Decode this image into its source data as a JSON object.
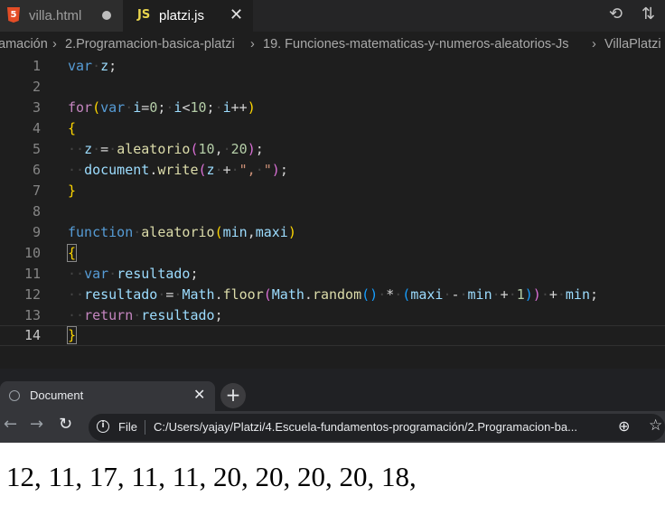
{
  "editor": {
    "tabs": [
      {
        "label": "villa.html",
        "icon": "html5-icon",
        "dirty": true
      },
      {
        "label": "platzi.js",
        "icon": "js-icon",
        "active": true
      }
    ],
    "breadcrumb": [
      "amación",
      "2.Programacion-basica-platzi",
      "19. Funciones-matematicas-y-numeros-aleatorios-Js",
      "VillaPlatzi"
    ],
    "line_numbers": [
      "1",
      "2",
      "3",
      "4",
      "5",
      "6",
      "7",
      "8",
      "9",
      "10",
      "11",
      "12",
      "13",
      "14"
    ],
    "current_line": 14
  },
  "browser": {
    "tab_title": "Document",
    "file_label": "File",
    "url": "C:/Users/yajay/Platzi/4.Escuela-fundamentos-programación/2.Programacion-ba..."
  },
  "page": {
    "output": "12, 11, 17, 11, 11, 20, 20, 20, 20, 18,"
  },
  "colors": {
    "editor_bg": "#1e1e1e",
    "keyword": "#569cd6",
    "control": "#c586c0",
    "function": "#dcdcaa",
    "variable": "#9cdcfe",
    "number": "#b5cea8",
    "string": "#ce9178"
  }
}
